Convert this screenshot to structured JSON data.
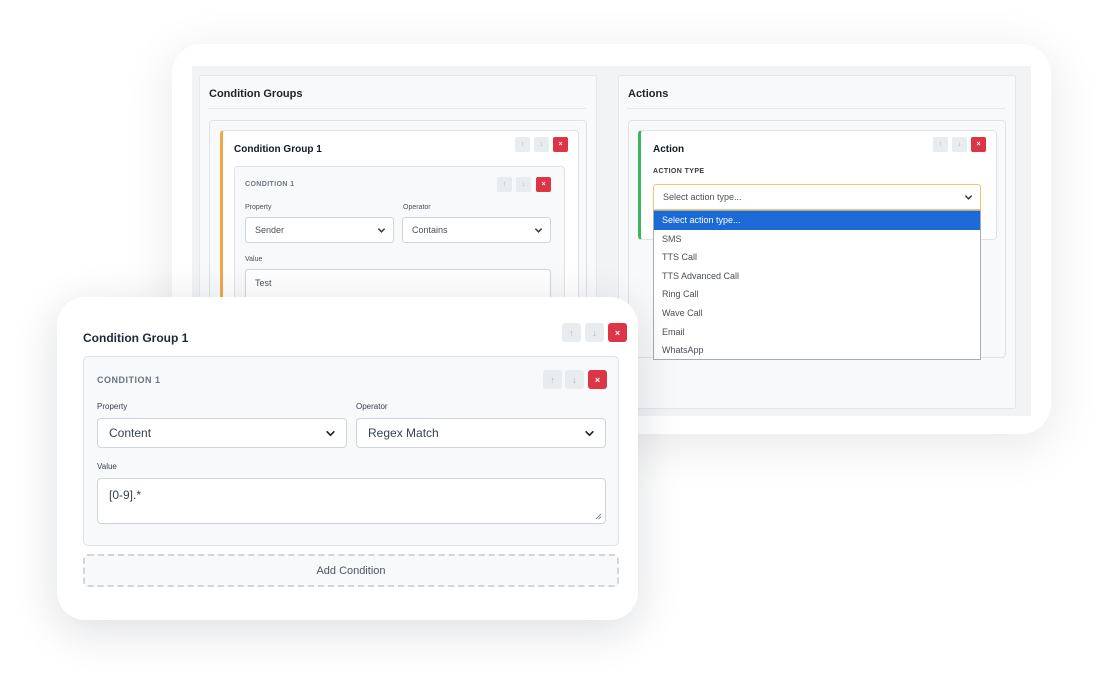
{
  "condition_groups": {
    "title": "Condition Groups",
    "group": {
      "title": "Condition Group 1",
      "condition": {
        "title": "CONDITION 1",
        "property_label": "Property",
        "property_value": "Sender",
        "operator_label": "Operator",
        "operator_value": "Contains",
        "value_label": "Value",
        "value": "Test"
      }
    }
  },
  "actions": {
    "title": "Actions",
    "action": {
      "title": "Action",
      "type_label": "ACTION TYPE",
      "type_placeholder": "Select action type...",
      "options": [
        "Select action type...",
        "SMS",
        "TTS Call",
        "TTS Advanced Call",
        "Ring Call",
        "Wave Call",
        "Email",
        "WhatsApp"
      ]
    }
  },
  "front": {
    "group_title": "Condition Group 1",
    "condition": {
      "title": "CONDITION 1",
      "property_label": "Property",
      "property_value": "Content",
      "operator_label": "Operator",
      "operator_value": "Regex Match",
      "value_label": "Value",
      "value": "[0-9].*"
    },
    "add_condition_label": "Add Condition"
  },
  "buttons": {
    "up": "↑",
    "down": "↓",
    "remove": "×"
  },
  "colors": {
    "group_accent": "#f0a848",
    "action_accent": "#3cb55e",
    "remove_button": "#dc3545",
    "selected_option": "#1b6ad6"
  }
}
